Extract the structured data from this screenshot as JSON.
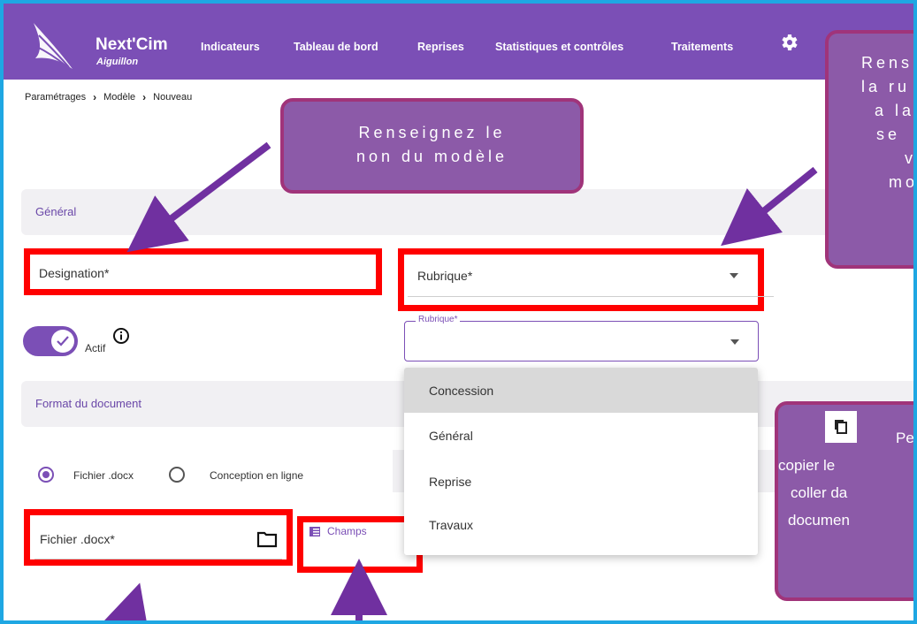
{
  "app": {
    "brand": "Next'Cim",
    "brand_sub": "Aiguillon"
  },
  "nav": {
    "items": [
      "Indicateurs",
      "Tableau de bord",
      "Reprises",
      "Statistiques et contrôles",
      "Traitements"
    ]
  },
  "breadcrumb": [
    "Paramétrages",
    "Modèle",
    "Nouveau"
  ],
  "sections": {
    "general": "Général",
    "format": "Format du document"
  },
  "form": {
    "designation_label": "Designation*",
    "rubrique_label": "Rubrique*",
    "rubrique_floating_label": "Rubrique*",
    "actif_label": "Actif",
    "fichier_label": "Fichier .docx*",
    "champs_label": "Champs"
  },
  "rubrique_options": [
    "Concession",
    "Général",
    "Reprise",
    "Travaux"
  ],
  "document_format": {
    "options": [
      "Fichier .docx",
      "Conception en ligne"
    ],
    "selected": "Fichier .docx"
  },
  "callouts": {
    "name_model": [
      "Renseignez le",
      "non du modèle"
    ],
    "rubrique_lines": [
      "Rens",
      "la ru",
      "a la",
      "se",
      "v",
      "mo"
    ],
    "copy_lines": [
      "Pe",
      "copier le",
      "coller da",
      "documen"
    ]
  },
  "colors": {
    "primary": "#7b4fb6",
    "highlight": "#ff0000",
    "callout": "#8c5aa8",
    "frame": "#1ea7e3"
  },
  "icons": {
    "settings": "gear-icon",
    "folder": "folder-icon",
    "info": "info-icon",
    "copy": "copy-icon",
    "table": "table-icon"
  }
}
